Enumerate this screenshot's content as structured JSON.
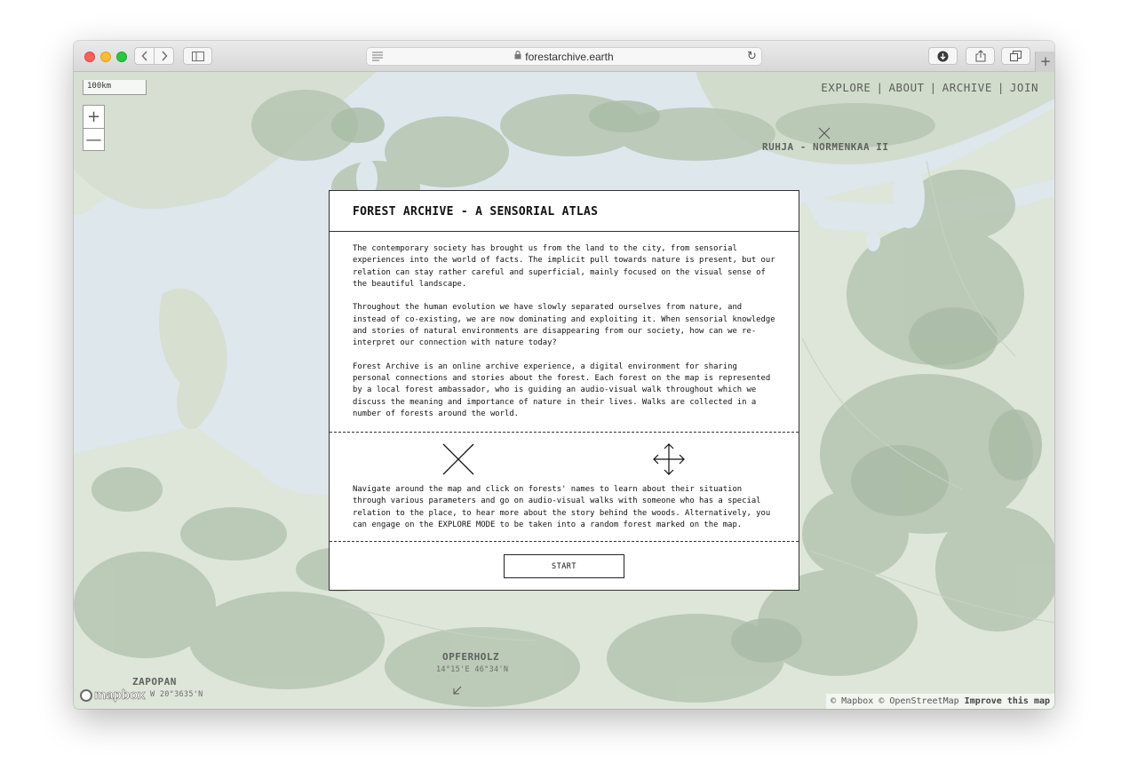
{
  "browser": {
    "url": "forestarchive.earth",
    "icons": [
      "back-chevron-icon",
      "forward-chevron-icon",
      "sidebar-icon",
      "reader-icon",
      "lock-icon",
      "reload-icon",
      "download-icon",
      "share-icon",
      "tabs-icon",
      "plus-icon"
    ]
  },
  "map": {
    "scale_label": "100km",
    "zoom_in": "+",
    "zoom_out": "—",
    "nav": {
      "explore": "EXPLORE",
      "about": "ABOUT",
      "archive": "ARCHIVE",
      "join": "JOIN",
      "separator": "|"
    },
    "labels": {
      "north_forest": "RUHJA - NORMENKAA II",
      "opferholz": "OPFERHOLZ",
      "opferholz_coord": "14°15'E 46°34'N",
      "zapopan": "ZAPOPAN",
      "zapopan_coord": "W 20°3635'N"
    },
    "attribution": {
      "mapbox": "© Mapbox",
      "osm": "© OpenStreetMap",
      "improve": "Improve this map"
    },
    "logo": "mapbox",
    "colors": {
      "water": "#dde7ec",
      "land": "#dee5d9",
      "forest": "#b6c6b2"
    }
  },
  "modal": {
    "title": "FOREST ARCHIVE - A SENSORIAL ATLAS",
    "paragraphs": [
      "The contemporary society has brought us from the land to the city, from sensorial experiences into the world of facts. The implicit pull towards nature is present, but our relation can stay rather careful and superficial, mainly focused on the visual sense of the beautiful landscape.",
      "Throughout the human evolution we have slowly separated ourselves from nature, and instead of co-existing, we are now dominating and exploiting it. When sensorial knowledge and stories of natural environments are disappearing from our society, how can we re-interpret our connection with nature today?",
      "Forest Archive is an online archive experience, a digital environment for sharing personal connections and stories about the forest. Each forest on the map is represented by a local forest ambassador, who is guiding an audio-visual walk throughout which we discuss the meaning and importance of nature in their lives. Walks are collected in a number of forests around the world."
    ],
    "navigation_text": "Navigate around the map and click on forests' names to learn about their situation through various parameters and go on audio-visual walks with someone who has a special relation to the place, to hear more about the story behind the woods. Alternatively, you can engage on the EXPLORE MODE to be taken into a random forest marked on the map.",
    "start_label": "START"
  }
}
